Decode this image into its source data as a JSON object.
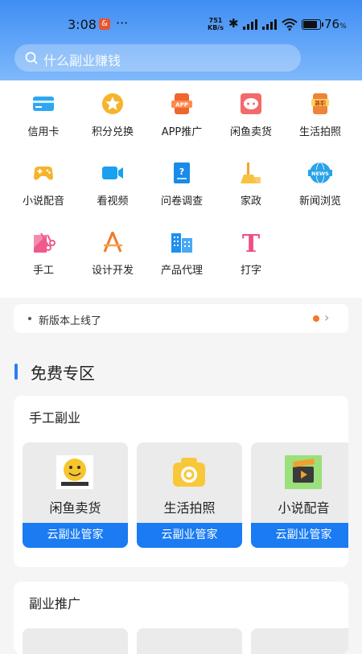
{
  "status_bar": {
    "time": "3:08",
    "notif_badge": "&",
    "more": "···",
    "net_speed_value": "751",
    "net_speed_unit": "KB/s",
    "battery_percent": "76",
    "battery_unit": "%"
  },
  "search": {
    "placeholder": "什么副业赚钱"
  },
  "grid": [
    {
      "label": "信用卡",
      "icon": "credit-card-icon"
    },
    {
      "label": "积分兑换",
      "icon": "points-star-icon"
    },
    {
      "label": "APP推广",
      "icon": "app-promo-icon",
      "icon_text": "APP"
    },
    {
      "label": "闲鱼卖货",
      "icon": "chat-bubble-icon"
    },
    {
      "label": "生活拍照",
      "icon": "photo-job-icon",
      "icon_text": "兼职"
    },
    {
      "label": "小说配音",
      "icon": "gamepad-icon"
    },
    {
      "label": "看视频",
      "icon": "video-camera-icon"
    },
    {
      "label": "问卷调查",
      "icon": "survey-doc-icon"
    },
    {
      "label": "家政",
      "icon": "housekeeping-icon"
    },
    {
      "label": "新闻浏览",
      "icon": "news-globe-icon",
      "icon_text": "NEWS"
    },
    {
      "label": "手工",
      "icon": "scissors-icon"
    },
    {
      "label": "设计开发",
      "icon": "design-tools-icon"
    },
    {
      "label": "产品代理",
      "icon": "buildings-icon"
    },
    {
      "label": "打字",
      "icon": "typing-t-icon",
      "icon_text": "T"
    }
  ],
  "notice": {
    "text": "新版本上线了"
  },
  "section": {
    "title": "免费专区"
  },
  "cards": [
    {
      "title": "手工副业",
      "tiles": [
        {
          "name": "闲鱼卖货",
          "button": "云副业管家",
          "icon": "fish-sticker-icon"
        },
        {
          "name": "生活拍照",
          "button": "云副业管家",
          "icon": "camera-icon"
        },
        {
          "name": "小说配音",
          "button": "云副业管家",
          "icon": "clapperboard-icon"
        }
      ]
    },
    {
      "title": "副业推广"
    }
  ],
  "colors": {
    "accent": "#1a7bf2",
    "header": "#4a93f5",
    "notice_dot": "#f07a2b"
  }
}
